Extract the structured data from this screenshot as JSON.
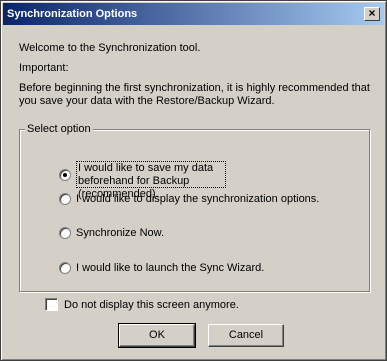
{
  "dialog": {
    "title": "Synchronization Options",
    "close_glyph": "×",
    "welcome": "Welcome to the Synchronization tool.",
    "important": "Important:",
    "recommendation": "Before beginning the first synchronization, it is highly recommended that you save your data with the Restore/Backup Wizard."
  },
  "options": {
    "group_label": "Select option",
    "selected_index": 0,
    "items": [
      {
        "label": "I would like to save my data beforehand for Backup (recommended)."
      },
      {
        "label": "I would like to display the synchronization options."
      },
      {
        "label": "Synchronize Now."
      },
      {
        "label": "I would like to launch the Sync Wizard."
      }
    ]
  },
  "checkbox": {
    "label": "Do not display this screen anymore.",
    "checked": false
  },
  "buttons": {
    "ok": "OK",
    "cancel": "Cancel"
  },
  "colors": {
    "titlebar_start": "#0a246a",
    "titlebar_end": "#a6caf0",
    "face": "#d4d0c8"
  }
}
